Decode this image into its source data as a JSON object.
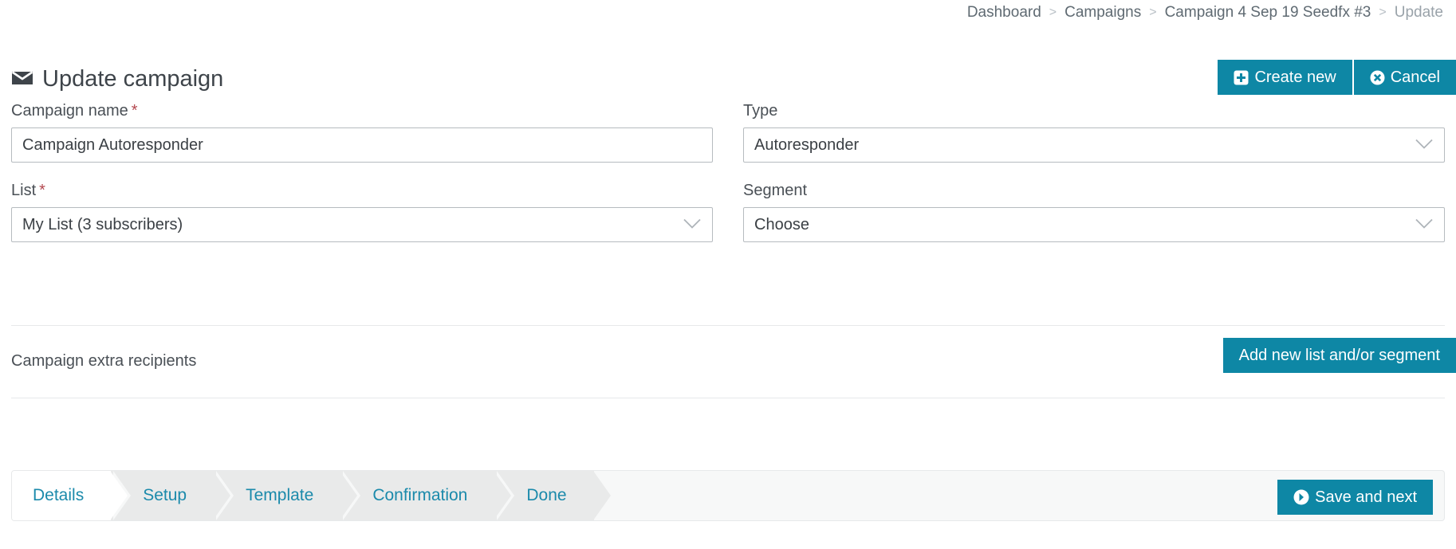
{
  "breadcrumb": {
    "items": [
      {
        "label": "Dashboard",
        "current": false
      },
      {
        "label": "Campaigns",
        "current": false
      },
      {
        "label": "Campaign 4 Sep 19 Seedfx #3",
        "current": false
      },
      {
        "label": "Update",
        "current": true
      }
    ],
    "separator": ">"
  },
  "header": {
    "title": "Update campaign",
    "icon": "envelope-icon",
    "actions": {
      "create_new": {
        "label": "Create new",
        "icon": "plus-square-icon"
      },
      "cancel": {
        "label": "Cancel",
        "icon": "circle-x-icon"
      }
    }
  },
  "form": {
    "campaign_name": {
      "label": "Campaign name",
      "required_marker": "*",
      "value": "Campaign Autoresponder",
      "placeholder": ""
    },
    "type": {
      "label": "Type",
      "value": "Autoresponder",
      "icon": "chevron-down-icon"
    },
    "list": {
      "label": "List",
      "required_marker": "*",
      "value": "My List (3 subscribers)",
      "icon": "chevron-down-icon"
    },
    "segment": {
      "label": "Segment",
      "value": "Choose",
      "icon": "chevron-down-icon"
    }
  },
  "extra_recipients": {
    "label": "Campaign extra recipients",
    "add_button": {
      "label": "Add new list and/or segment"
    }
  },
  "wizard": {
    "steps": [
      {
        "label": "Details",
        "active": true
      },
      {
        "label": "Setup",
        "active": false
      },
      {
        "label": "Template",
        "active": false
      },
      {
        "label": "Confirmation",
        "active": false
      },
      {
        "label": "Done",
        "active": false
      }
    ],
    "save_button": {
      "label": "Save and next",
      "icon": "circle-arrow-right-icon"
    }
  },
  "colors": {
    "accent": "#0e87a5",
    "step_text": "#1b8aab",
    "required": "#b3484f",
    "border": "#b6bbbf"
  }
}
